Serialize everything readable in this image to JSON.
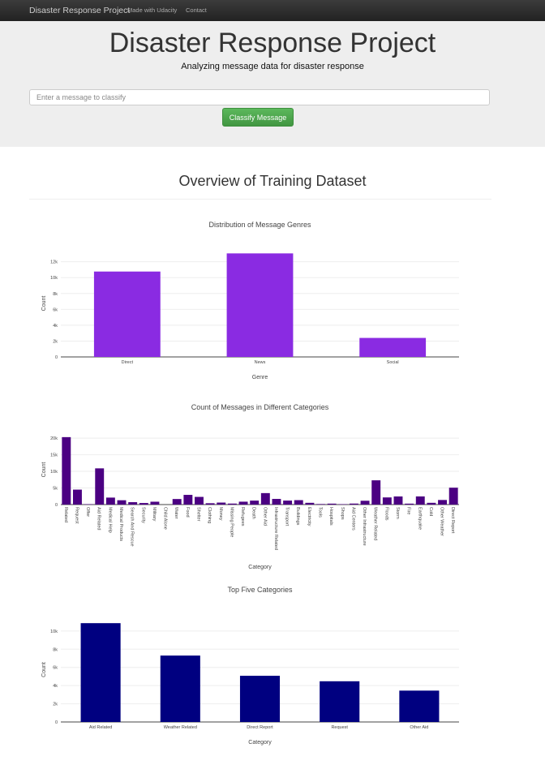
{
  "navbar": {
    "brand": "Disaster Response Project",
    "links": [
      "Made with Udacity",
      "Contact"
    ]
  },
  "hero": {
    "title": "Disaster Response Project",
    "subtitle": "Analyzing message data for disaster response",
    "input_placeholder": "Enter a message to classify",
    "button_label": "Classify Message",
    "button_color": "#5cb85c"
  },
  "overview_title": "Overview of Training Dataset",
  "chart_data": [
    {
      "type": "bar",
      "title": "Distribution of Message Genres",
      "xlabel": "Genre",
      "ylabel": "Count",
      "color": "#8a2be2",
      "categories": [
        "Direct",
        "News",
        "Social"
      ],
      "values": [
        10766,
        13054,
        2396
      ],
      "ylim": [
        0,
        13500
      ],
      "yticks": [
        0,
        2000,
        4000,
        6000,
        8000,
        10000,
        12000
      ],
      "ytick_labels": [
        "0",
        "2k",
        "4k",
        "6k",
        "8k",
        "10k",
        "12k"
      ],
      "grid": true
    },
    {
      "type": "bar",
      "title": "Count of Messages in Different Categories",
      "xlabel": "Category",
      "ylabel": "Count",
      "color": "#4b0082",
      "categories": [
        "Related",
        "Request",
        "Offer",
        "Aid Related",
        "Medical Help",
        "Medical Products",
        "Search And Rescue",
        "Security",
        "Military",
        "Child Alone",
        "Water",
        "Food",
        "Shelter",
        "Clothing",
        "Money",
        "Missing People",
        "Refugees",
        "Death",
        "Other Aid",
        "Infrastructure Related",
        "Transport",
        "Buildings",
        "Electricity",
        "Tools",
        "Hospitals",
        "Shops",
        "Aid Centers",
        "Other Infrastructure",
        "Weather Related",
        "Floods",
        "Storm",
        "Fire",
        "Earthquake",
        "Cold",
        "Other Weather",
        "Direct Report"
      ],
      "values": [
        20300,
        4500,
        120,
        10900,
        2100,
        1300,
        720,
        470,
        860,
        0,
        1670,
        2920,
        2310,
        400,
        600,
        300,
        870,
        1190,
        3450,
        1700,
        1200,
        1330,
        530,
        160,
        280,
        120,
        300,
        1150,
        7300,
        2150,
        2440,
        280,
        2450,
        530,
        1380,
        5080
      ],
      "ylim": [
        0,
        21000
      ],
      "yticks": [
        0,
        5000,
        10000,
        15000,
        20000
      ],
      "ytick_labels": [
        "0",
        "5k",
        "10k",
        "15k",
        "20k"
      ],
      "grid": true
    },
    {
      "type": "bar",
      "title": "Top Five Categories",
      "xlabel": "Category",
      "ylabel": "Count",
      "color": "#000080",
      "categories": [
        "Aid Related",
        "Weather Related",
        "Direct Report",
        "Request",
        "Other Aid"
      ],
      "values": [
        10860,
        7297,
        5075,
        4474,
        3446
      ],
      "ylim": [
        0,
        11500
      ],
      "yticks": [
        0,
        2000,
        4000,
        6000,
        8000,
        10000
      ],
      "ytick_labels": [
        "0",
        "2k",
        "4k",
        "6k",
        "8k",
        "10k"
      ],
      "grid": true
    }
  ]
}
